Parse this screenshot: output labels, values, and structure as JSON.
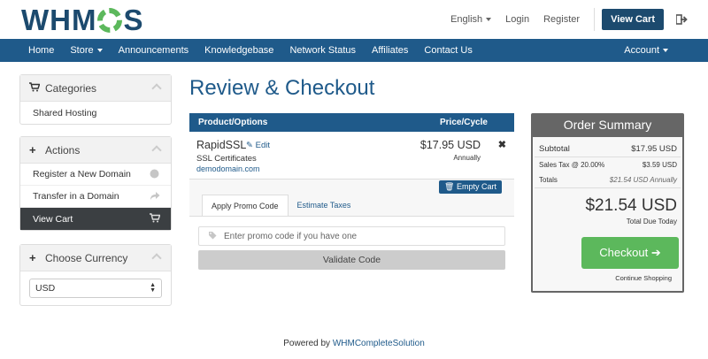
{
  "brand": {
    "logo_text_1": "WHM",
    "logo_text_2": "S"
  },
  "top": {
    "language": "English",
    "login": "Login",
    "register": "Register",
    "view_cart": "View Cart"
  },
  "nav": {
    "items": [
      "Home",
      "Store",
      "Announcements",
      "Knowledgebase",
      "Network Status",
      "Affiliates",
      "Contact Us"
    ],
    "account": "Account"
  },
  "sidebar": {
    "categories": {
      "title": "Categories",
      "items": [
        "Shared Hosting"
      ]
    },
    "actions": {
      "title": "Actions",
      "items": [
        "Register a New Domain",
        "Transfer in a Domain",
        "View Cart"
      ]
    },
    "currency": {
      "title": "Choose Currency",
      "selected": "USD"
    }
  },
  "main": {
    "title": "Review & Checkout",
    "cart": {
      "col_product": "Product/Options",
      "col_price": "Price/Cycle",
      "item": {
        "name": "RapidSSL",
        "edit": "Edit",
        "group": "SSL Certificates",
        "domain": "demodomain.com",
        "price": "$17.95 USD",
        "cycle": "Annually"
      },
      "empty_cart": "Empty Cart",
      "tabs": [
        "Apply Promo Code",
        "Estimate Taxes"
      ],
      "promo_placeholder": "Enter promo code if you have one",
      "validate": "Validate Code"
    }
  },
  "summary": {
    "title": "Order Summary",
    "subtotal_label": "Subtotal",
    "subtotal_value": "$17.95 USD",
    "tax_label": "Sales Tax @ 20.00%",
    "tax_value": "$3.59 USD",
    "totals_label": "Totals",
    "totals_value": "$21.54 USD Annually",
    "total": "$21.54 USD",
    "due_today": "Total Due Today",
    "checkout": "Checkout",
    "continue": "Continue Shopping"
  },
  "footer": {
    "prefix": "Powered by",
    "link": "WHMCompleteSolution"
  },
  "colors": {
    "primary": "#1f5a8a",
    "success": "#5cb85c",
    "dark": "#3b3f42"
  }
}
